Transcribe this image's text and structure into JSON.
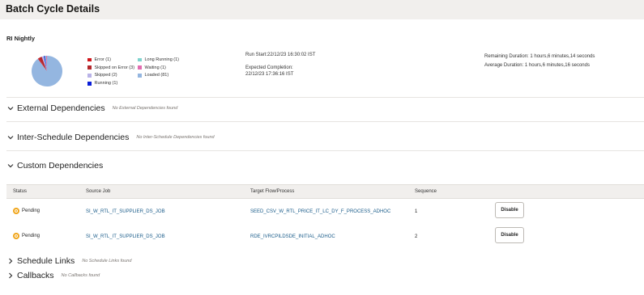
{
  "page": {
    "title": "Batch Cycle Details"
  },
  "summary": {
    "schedule_name": "RI Nightly",
    "run_start": "Run Start:22/12/23 16:30:02 IST",
    "expected_completion_label": "Expected Completion:",
    "expected_completion_value": "22/12/23 17:36:16 IST",
    "remaining_duration": "Remaining Duration: 1 hours,6 minutes,14 seconds",
    "average_duration": "Average Duration: 1 hours,6 minutes,16 seconds"
  },
  "status_chart": {
    "legend": [
      {
        "label": "Error (1)",
        "color": "#d0161b"
      },
      {
        "label": "Skipped on Error (3)",
        "color": "#b3272c"
      },
      {
        "label": "Skipped (2)",
        "color": "#b9b3e8"
      },
      {
        "label": "Running (1)",
        "color": "#0a1ed8"
      },
      {
        "label": "Long Running (1)",
        "color": "#7ed3ce"
      },
      {
        "label": "Waiting (1)",
        "color": "#e26bb0"
      },
      {
        "label": "Loaded (81)",
        "color": "#94b6e0"
      }
    ]
  },
  "sections": {
    "external": {
      "label": "External Dependencies",
      "note": "No External Dependencies found"
    },
    "inter_schedule": {
      "label": "Inter-Schedule Dependencies",
      "note": "No Inter-Schedule Dependencies found"
    },
    "custom": {
      "label": "Custom Dependencies"
    },
    "schedule_links": {
      "label": "Schedule Links",
      "note": "No Schedule Links found"
    },
    "callbacks": {
      "label": "Callbacks",
      "note": "No Callbacks found"
    }
  },
  "table": {
    "headers": [
      "Status",
      "Source Job",
      "Target Flow/Process",
      "Sequence"
    ],
    "rows": [
      {
        "status": "Pending",
        "source_job": "SI_W_RTL_IT_SUPPLIER_DS_JOB",
        "target": "SEED_CSV_W_RTL_PRICE_IT_LC_DY_F_PROCESS_ADHOC",
        "sequence": "1",
        "action": "Disable"
      },
      {
        "status": "Pending",
        "source_job": "SI_W_RTL_IT_SUPPLIER_DS_JOB",
        "target": "RDE_IVRCPILDSDE_INITIAL_ADHOC",
        "sequence": "2",
        "action": "Disable"
      }
    ]
  }
}
